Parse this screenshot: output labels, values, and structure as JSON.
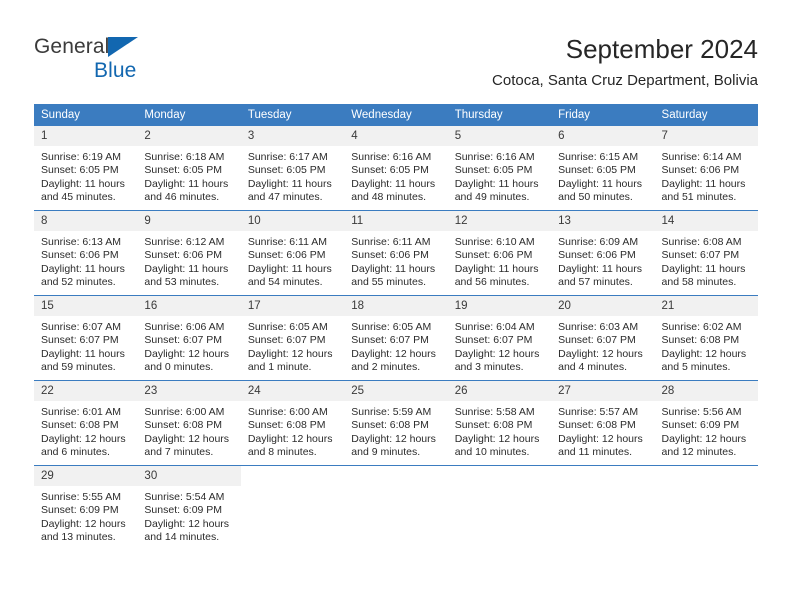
{
  "brand": {
    "name_part1": "General",
    "name_part2": "Blue",
    "accent_color": "#1267b0"
  },
  "header": {
    "title": "September 2024",
    "subtitle": "Cotoca, Santa Cruz Department, Bolivia"
  },
  "calendar": {
    "header_color": "#3b7cc0",
    "daynum_band_color": "#f1f1f1",
    "weekdays": [
      "Sunday",
      "Monday",
      "Tuesday",
      "Wednesday",
      "Thursday",
      "Friday",
      "Saturday"
    ],
    "weeks": [
      [
        {
          "day": "1",
          "sunrise": "Sunrise: 6:19 AM",
          "sunset": "Sunset: 6:05 PM",
          "daylight_line1": "Daylight: 11 hours",
          "daylight_line2": "and 45 minutes."
        },
        {
          "day": "2",
          "sunrise": "Sunrise: 6:18 AM",
          "sunset": "Sunset: 6:05 PM",
          "daylight_line1": "Daylight: 11 hours",
          "daylight_line2": "and 46 minutes."
        },
        {
          "day": "3",
          "sunrise": "Sunrise: 6:17 AM",
          "sunset": "Sunset: 6:05 PM",
          "daylight_line1": "Daylight: 11 hours",
          "daylight_line2": "and 47 minutes."
        },
        {
          "day": "4",
          "sunrise": "Sunrise: 6:16 AM",
          "sunset": "Sunset: 6:05 PM",
          "daylight_line1": "Daylight: 11 hours",
          "daylight_line2": "and 48 minutes."
        },
        {
          "day": "5",
          "sunrise": "Sunrise: 6:16 AM",
          "sunset": "Sunset: 6:05 PM",
          "daylight_line1": "Daylight: 11 hours",
          "daylight_line2": "and 49 minutes."
        },
        {
          "day": "6",
          "sunrise": "Sunrise: 6:15 AM",
          "sunset": "Sunset: 6:05 PM",
          "daylight_line1": "Daylight: 11 hours",
          "daylight_line2": "and 50 minutes."
        },
        {
          "day": "7",
          "sunrise": "Sunrise: 6:14 AM",
          "sunset": "Sunset: 6:06 PM",
          "daylight_line1": "Daylight: 11 hours",
          "daylight_line2": "and 51 minutes."
        }
      ],
      [
        {
          "day": "8",
          "sunrise": "Sunrise: 6:13 AM",
          "sunset": "Sunset: 6:06 PM",
          "daylight_line1": "Daylight: 11 hours",
          "daylight_line2": "and 52 minutes."
        },
        {
          "day": "9",
          "sunrise": "Sunrise: 6:12 AM",
          "sunset": "Sunset: 6:06 PM",
          "daylight_line1": "Daylight: 11 hours",
          "daylight_line2": "and 53 minutes."
        },
        {
          "day": "10",
          "sunrise": "Sunrise: 6:11 AM",
          "sunset": "Sunset: 6:06 PM",
          "daylight_line1": "Daylight: 11 hours",
          "daylight_line2": "and 54 minutes."
        },
        {
          "day": "11",
          "sunrise": "Sunrise: 6:11 AM",
          "sunset": "Sunset: 6:06 PM",
          "daylight_line1": "Daylight: 11 hours",
          "daylight_line2": "and 55 minutes."
        },
        {
          "day": "12",
          "sunrise": "Sunrise: 6:10 AM",
          "sunset": "Sunset: 6:06 PM",
          "daylight_line1": "Daylight: 11 hours",
          "daylight_line2": "and 56 minutes."
        },
        {
          "day": "13",
          "sunrise": "Sunrise: 6:09 AM",
          "sunset": "Sunset: 6:06 PM",
          "daylight_line1": "Daylight: 11 hours",
          "daylight_line2": "and 57 minutes."
        },
        {
          "day": "14",
          "sunrise": "Sunrise: 6:08 AM",
          "sunset": "Sunset: 6:07 PM",
          "daylight_line1": "Daylight: 11 hours",
          "daylight_line2": "and 58 minutes."
        }
      ],
      [
        {
          "day": "15",
          "sunrise": "Sunrise: 6:07 AM",
          "sunset": "Sunset: 6:07 PM",
          "daylight_line1": "Daylight: 11 hours",
          "daylight_line2": "and 59 minutes."
        },
        {
          "day": "16",
          "sunrise": "Sunrise: 6:06 AM",
          "sunset": "Sunset: 6:07 PM",
          "daylight_line1": "Daylight: 12 hours",
          "daylight_line2": "and 0 minutes."
        },
        {
          "day": "17",
          "sunrise": "Sunrise: 6:05 AM",
          "sunset": "Sunset: 6:07 PM",
          "daylight_line1": "Daylight: 12 hours",
          "daylight_line2": "and 1 minute."
        },
        {
          "day": "18",
          "sunrise": "Sunrise: 6:05 AM",
          "sunset": "Sunset: 6:07 PM",
          "daylight_line1": "Daylight: 12 hours",
          "daylight_line2": "and 2 minutes."
        },
        {
          "day": "19",
          "sunrise": "Sunrise: 6:04 AM",
          "sunset": "Sunset: 6:07 PM",
          "daylight_line1": "Daylight: 12 hours",
          "daylight_line2": "and 3 minutes."
        },
        {
          "day": "20",
          "sunrise": "Sunrise: 6:03 AM",
          "sunset": "Sunset: 6:07 PM",
          "daylight_line1": "Daylight: 12 hours",
          "daylight_line2": "and 4 minutes."
        },
        {
          "day": "21",
          "sunrise": "Sunrise: 6:02 AM",
          "sunset": "Sunset: 6:08 PM",
          "daylight_line1": "Daylight: 12 hours",
          "daylight_line2": "and 5 minutes."
        }
      ],
      [
        {
          "day": "22",
          "sunrise": "Sunrise: 6:01 AM",
          "sunset": "Sunset: 6:08 PM",
          "daylight_line1": "Daylight: 12 hours",
          "daylight_line2": "and 6 minutes."
        },
        {
          "day": "23",
          "sunrise": "Sunrise: 6:00 AM",
          "sunset": "Sunset: 6:08 PM",
          "daylight_line1": "Daylight: 12 hours",
          "daylight_line2": "and 7 minutes."
        },
        {
          "day": "24",
          "sunrise": "Sunrise: 6:00 AM",
          "sunset": "Sunset: 6:08 PM",
          "daylight_line1": "Daylight: 12 hours",
          "daylight_line2": "and 8 minutes."
        },
        {
          "day": "25",
          "sunrise": "Sunrise: 5:59 AM",
          "sunset": "Sunset: 6:08 PM",
          "daylight_line1": "Daylight: 12 hours",
          "daylight_line2": "and 9 minutes."
        },
        {
          "day": "26",
          "sunrise": "Sunrise: 5:58 AM",
          "sunset": "Sunset: 6:08 PM",
          "daylight_line1": "Daylight: 12 hours",
          "daylight_line2": "and 10 minutes."
        },
        {
          "day": "27",
          "sunrise": "Sunrise: 5:57 AM",
          "sunset": "Sunset: 6:08 PM",
          "daylight_line1": "Daylight: 12 hours",
          "daylight_line2": "and 11 minutes."
        },
        {
          "day": "28",
          "sunrise": "Sunrise: 5:56 AM",
          "sunset": "Sunset: 6:09 PM",
          "daylight_line1": "Daylight: 12 hours",
          "daylight_line2": "and 12 minutes."
        }
      ],
      [
        {
          "day": "29",
          "sunrise": "Sunrise: 5:55 AM",
          "sunset": "Sunset: 6:09 PM",
          "daylight_line1": "Daylight: 12 hours",
          "daylight_line2": "and 13 minutes."
        },
        {
          "day": "30",
          "sunrise": "Sunrise: 5:54 AM",
          "sunset": "Sunset: 6:09 PM",
          "daylight_line1": "Daylight: 12 hours",
          "daylight_line2": "and 14 minutes."
        },
        {
          "day": "",
          "sunrise": "",
          "sunset": "",
          "daylight_line1": "",
          "daylight_line2": ""
        },
        {
          "day": "",
          "sunrise": "",
          "sunset": "",
          "daylight_line1": "",
          "daylight_line2": ""
        },
        {
          "day": "",
          "sunrise": "",
          "sunset": "",
          "daylight_line1": "",
          "daylight_line2": ""
        },
        {
          "day": "",
          "sunrise": "",
          "sunset": "",
          "daylight_line1": "",
          "daylight_line2": ""
        },
        {
          "day": "",
          "sunrise": "",
          "sunset": "",
          "daylight_line1": "",
          "daylight_line2": ""
        }
      ]
    ]
  }
}
